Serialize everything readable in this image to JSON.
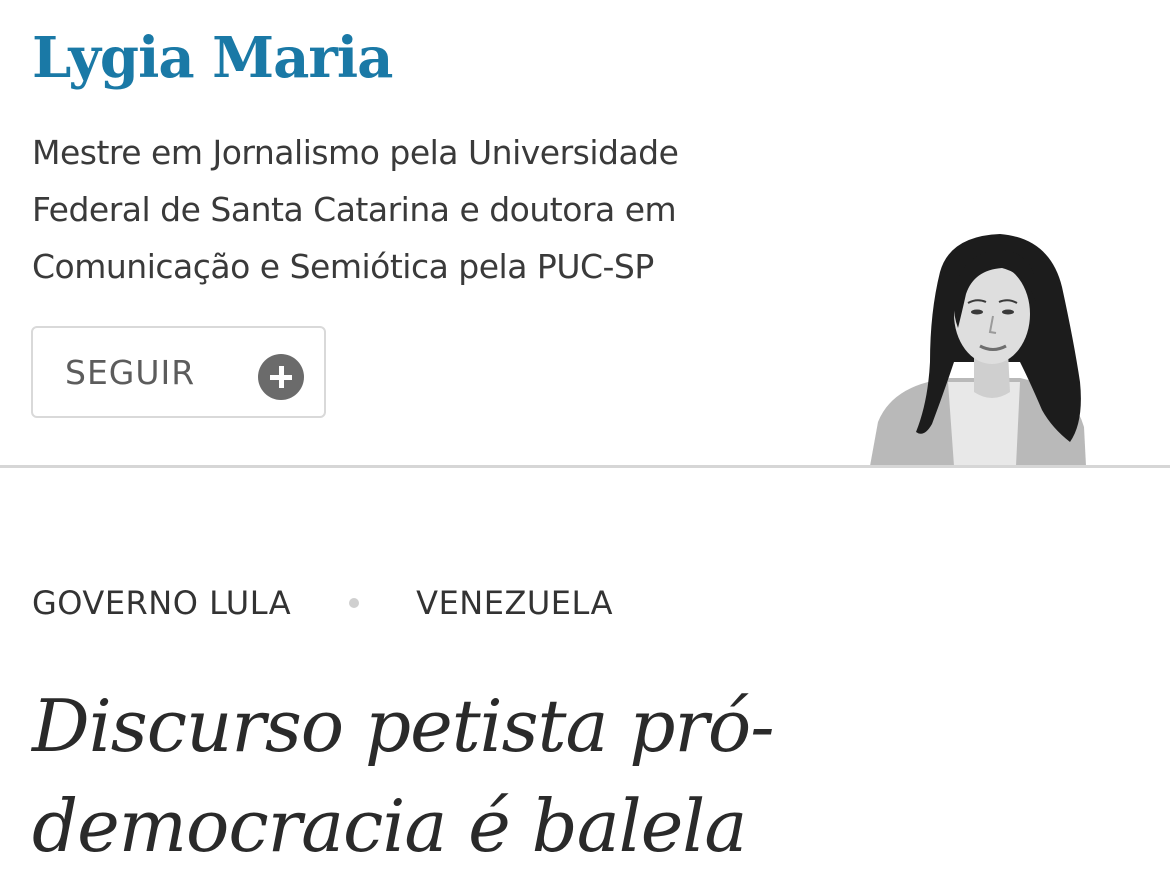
{
  "author": {
    "name": "Lygia Maria",
    "bio": "Mestre em Jornalismo pela Universidade Federal de Santa Catarina e doutora em Comunicação e Semiótica pela PUC-SP",
    "follow_label": "SEGUIR",
    "follow_icon": "plus-circle-icon",
    "name_color": "#1a79a6"
  },
  "article": {
    "tags": [
      "GOVERNO LULA",
      "VENEZUELA"
    ],
    "headline": "Discurso petista pró-democracia é balela"
  }
}
